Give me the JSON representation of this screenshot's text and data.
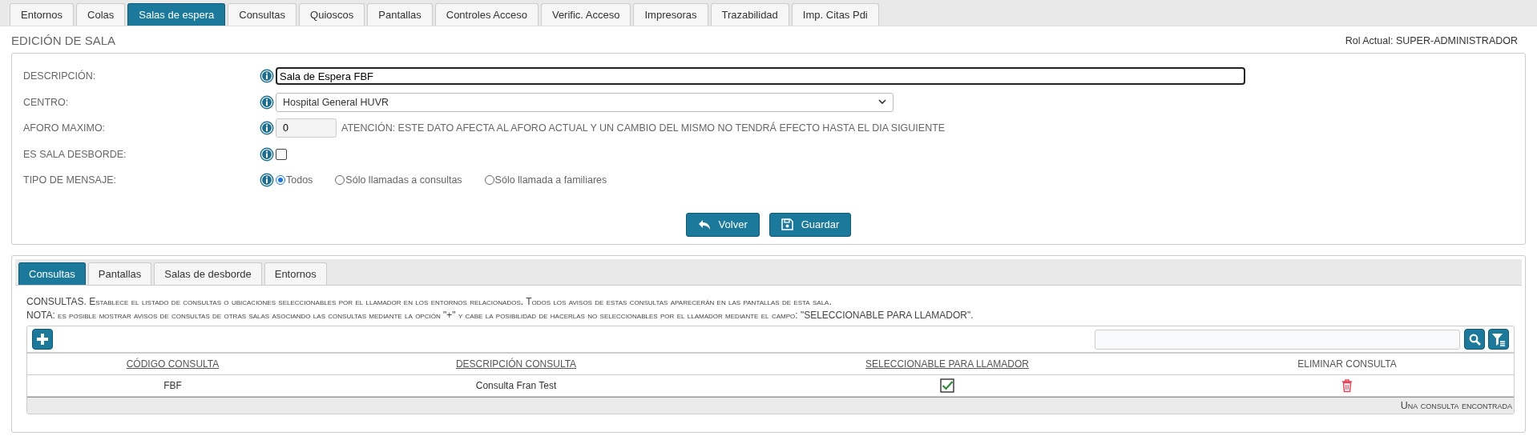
{
  "main_tabs": [
    {
      "label": "Entornos",
      "selected": false
    },
    {
      "label": "Colas",
      "selected": false
    },
    {
      "label": "Salas de espera",
      "selected": true
    },
    {
      "label": "Consultas",
      "selected": false
    },
    {
      "label": "Quioscos",
      "selected": false
    },
    {
      "label": "Pantallas",
      "selected": false
    },
    {
      "label": "Controles Acceso",
      "selected": false
    },
    {
      "label": "Verific. Acceso",
      "selected": false
    },
    {
      "label": "Impresoras",
      "selected": false
    },
    {
      "label": "Trazabilidad",
      "selected": false
    },
    {
      "label": "Imp. Citas Pdi",
      "selected": false
    }
  ],
  "page_title": "EDICIÓN DE SALA",
  "role": "Rol Actual: SUPER-ADMINISTRADOR",
  "form": {
    "fields": [
      {
        "kind": "text",
        "label": "DESCRIPCIÓN:",
        "value": "Sala de Espera FBF"
      },
      {
        "kind": "select",
        "label": "CENTRO:",
        "value": "Hospital General HUVR"
      },
      {
        "kind": "number",
        "label": "AFORO MAXIMO:",
        "value": "0",
        "note": "ATENCIÓN: ESTE DATO AFECTA AL AFORO ACTUAL Y UN CAMBIO DEL MISMO NO TENDRÁ EFECTO HASTA EL DIA SIGUIENTE"
      },
      {
        "kind": "checkbox",
        "label": "ES SALA DESBORDE:",
        "checked": false
      },
      {
        "kind": "radio",
        "label": "TIPO DE MENSAJE:",
        "options": [
          {
            "label": "Todos",
            "selected": true
          },
          {
            "label": "Sólo llamadas a consultas",
            "selected": false
          },
          {
            "label": "Sólo llamada a familiares",
            "selected": false
          }
        ]
      }
    ],
    "buttons": [
      {
        "kind": "back",
        "label": "Volver"
      },
      {
        "kind": "save",
        "label": "Guardar"
      }
    ]
  },
  "sub_tabs": [
    {
      "label": "Consultas",
      "selected": true
    },
    {
      "label": "Pantallas",
      "selected": false
    },
    {
      "label": "Salas de desborde",
      "selected": false
    },
    {
      "label": "Entornos",
      "selected": false
    }
  ],
  "notes": [
    "CONSULTAS. Establece el listado de consultas o ubicaciones seleccionables por el llamador en los entornos relacionados. Todos los avisos de estas consultas aparecerán en las pantallas de esta sala.",
    "NOTA: es posible mostrar avisos de consultas de otras salas asociando las consultas mediante la opción \"+\" y cabe la posibilidad de hacerlas no seleccionables por el llamador mediante el campo: \"SELECCIONABLE PARA LLAMADOR\"."
  ],
  "table": {
    "columns": [
      {
        "label": "CÓDIGO CONSULTA",
        "sortable": true
      },
      {
        "label": "DESCRIPCIÓN CONSULTA",
        "sortable": true
      },
      {
        "label": "SELECCIONABLE PARA LLAMADOR",
        "sortable": true
      },
      {
        "label": "ELIMINAR CONSULTA",
        "sortable": false
      }
    ],
    "rows": [
      {
        "code": "FBF",
        "description": "Consulta Fran Test",
        "selectable": true
      }
    ],
    "footer": "Una consulta encontrada"
  }
}
